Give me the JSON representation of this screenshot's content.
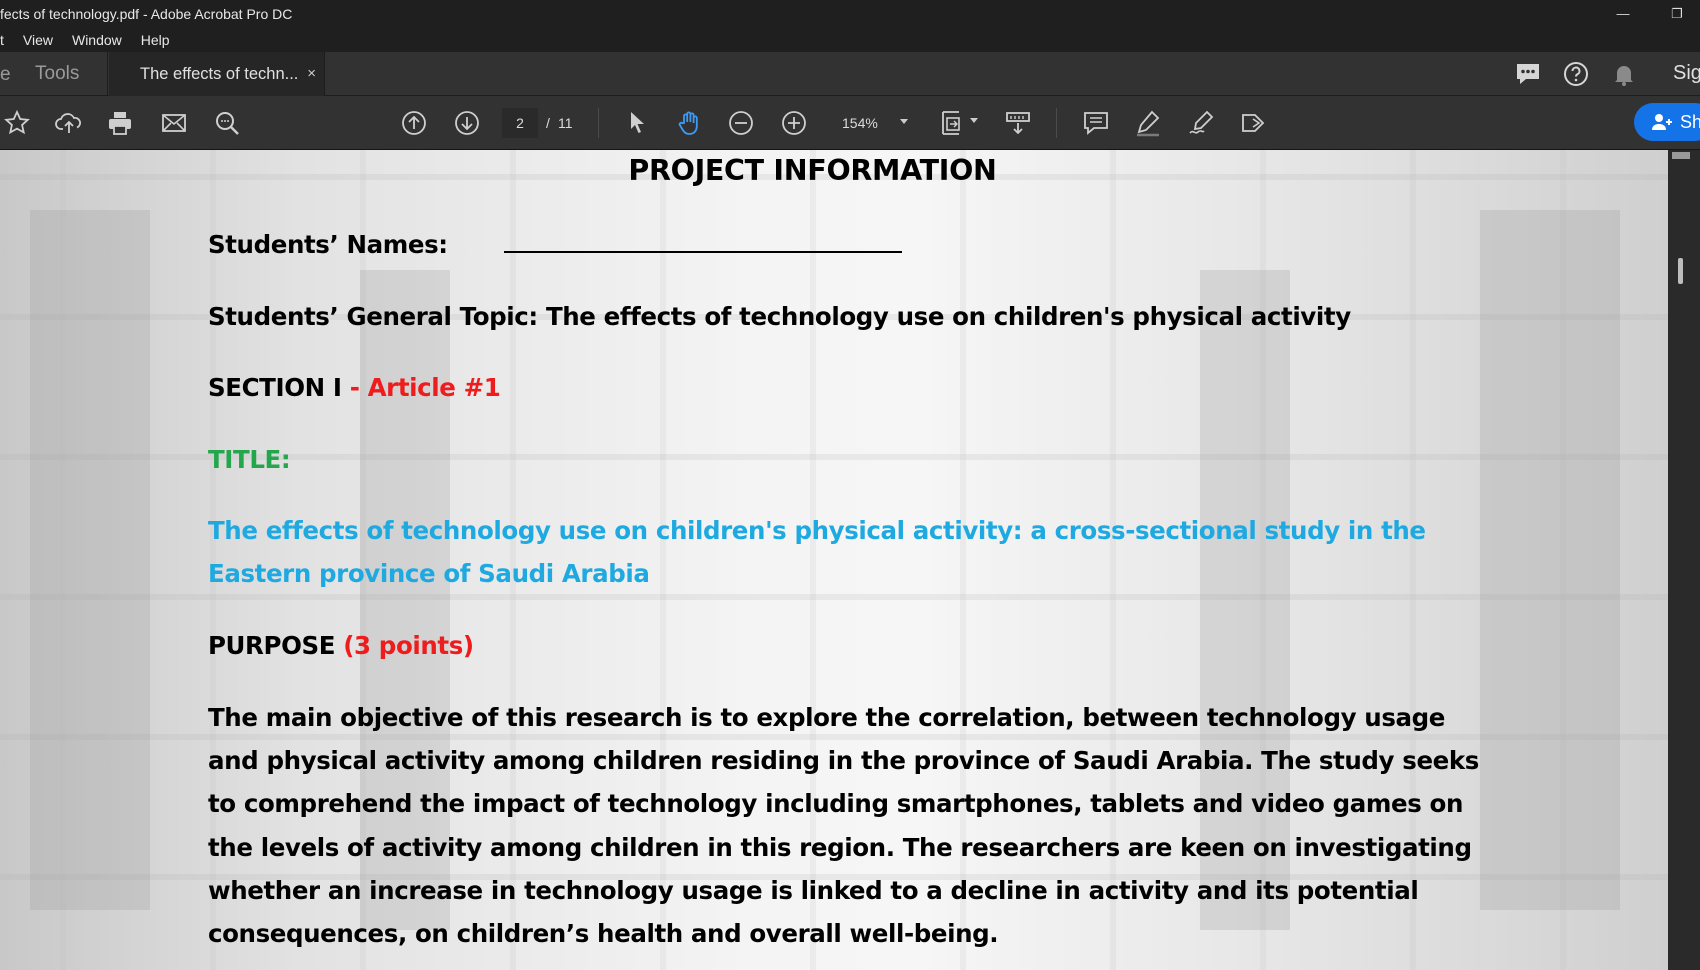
{
  "window": {
    "title": "fects of technology.pdf - Adobe Acrobat Pro DC",
    "minimize_glyph": "—",
    "restore_glyph": "❐"
  },
  "menu": {
    "items": [
      "t",
      "View",
      "Window",
      "Help"
    ]
  },
  "tabs": {
    "home_fragment": "e",
    "tools_label": "Tools",
    "doc_label": "The effects of techn...",
    "close_glyph": "×",
    "sign_label": "Sig"
  },
  "toolbar": {
    "current_page": "2",
    "page_separator": "/",
    "total_pages": "11",
    "zoom_level": "154%",
    "share_label": "Sh",
    "accent_color": "#1473e6",
    "hand_tool_color": "#3d9bf5",
    "icons": [
      "star-icon",
      "upload-cloud-icon",
      "print-icon",
      "mail-icon",
      "search-zoom-icon",
      "page-up-icon",
      "page-down-icon",
      "select-arrow-icon",
      "hand-tool-icon",
      "zoom-out-icon",
      "zoom-in-icon",
      "fit-page-icon",
      "scroll-mode-icon",
      "comment-icon",
      "highlight-icon",
      "sign-pen-icon",
      "stamp-icon"
    ]
  },
  "document": {
    "heading": "PROJECT INFORMATION",
    "students_names_label": "Students’ Names:",
    "topic_label": "Students’ General Topic:",
    "topic_value": "The effects of technology use on children's physical activity",
    "section_label": "SECTION I",
    "section_article": "- Article #1",
    "title_label": "TITLE:",
    "title_line1": "The effects of technology use on children's physical activity: a cross-sectional study in the",
    "title_line2": "Eastern province of Saudi Arabia",
    "purpose_label": "PURPOSE",
    "purpose_points": "(3 points)",
    "paragraph_lines": [
      "The main objective of this research is to explore the correlation, between technology usage",
      "and physical activity among children residing in the province of Saudi Arabia. The study seeks",
      "to comprehend the impact of technology including smartphones, tablets and video games on",
      "the levels of activity among children in this region. The researchers are keen on investigating",
      "whether an increase in technology usage is linked to a decline in activity and its potential",
      "consequences, on children’s health and overall well-being."
    ]
  }
}
